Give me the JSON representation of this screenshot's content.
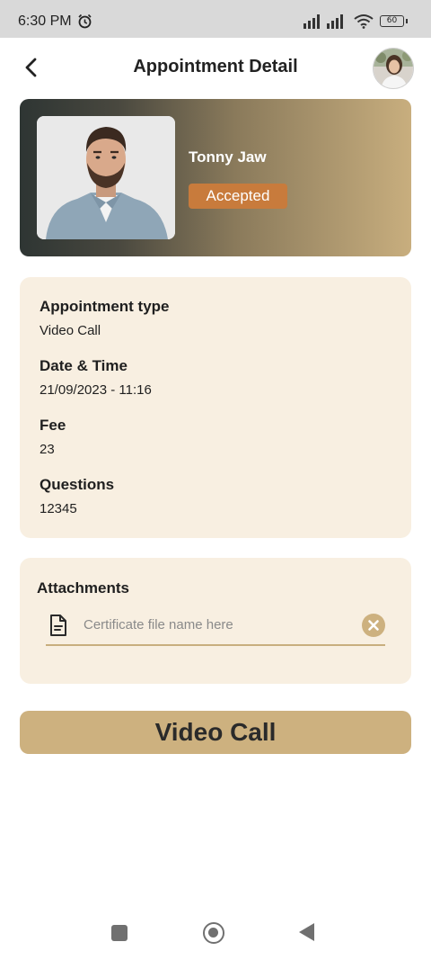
{
  "status_bar": {
    "time": "6:30 PM",
    "battery": "60",
    "icons": [
      "alarm-icon",
      "signal-icon",
      "signal-icon",
      "wifi-icon",
      "battery-icon"
    ]
  },
  "header": {
    "title": "Appointment Detail",
    "back_icon": "chevron-left-icon",
    "avatar": "user-avatar"
  },
  "profile": {
    "name": "Tonny Jaw",
    "status": "Accepted",
    "status_color": "#c87b3c"
  },
  "details": {
    "appointment_type_label": "Appointment type",
    "appointment_type_value": "Video Call",
    "datetime_label": "Date & Time",
    "datetime_value": "21/09/2023 - 11:16",
    "fee_label": "Fee",
    "fee_value": "23",
    "questions_label": "Questions",
    "questions_value": "12345"
  },
  "attachments": {
    "title": "Attachments",
    "file_name": "Certificate file name here",
    "file_icon": "document-icon",
    "remove_icon": "close-circle-icon"
  },
  "actions": {
    "video_call_label": "Video Call"
  },
  "colors": {
    "accent": "#cdb17f",
    "card_bg": "#f8efe1",
    "badge": "#c87b3c"
  }
}
